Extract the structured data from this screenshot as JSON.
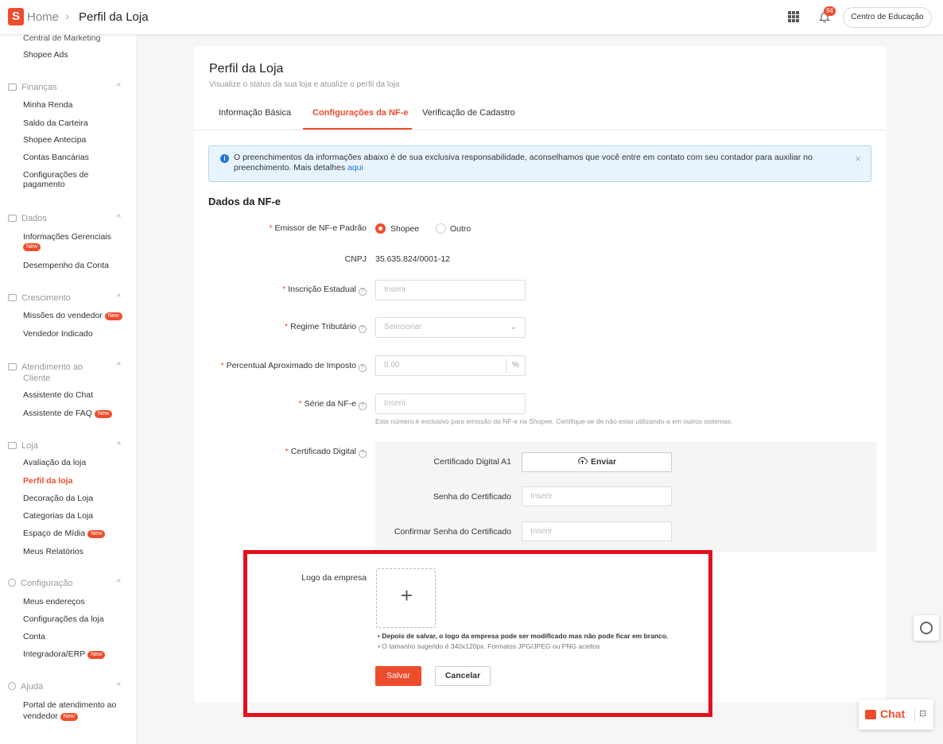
{
  "topbar": {
    "logo_letter": "S",
    "home": "Home",
    "sep": "›",
    "current": "Perfil da Loja",
    "notifications": "94",
    "education_button": "Centro de Educação"
  },
  "sidebar": {
    "marketing_partial": "Central de Marketing",
    "shopee_ads": "Shopee Ads",
    "financas": {
      "title": "Finanças",
      "items": [
        "Minha Renda",
        "Saldo da Carteira",
        "Shopee Antecipa",
        "Contas Bancárias",
        "Configurações de",
        "pagamento"
      ]
    },
    "dados": {
      "title": "Dados",
      "items": [
        "Informações Gerenciais",
        "Desempenho da Conta"
      ]
    },
    "crescimento": {
      "title": "Crescimento",
      "items": [
        "Missões do vendedor",
        "Vendedor Indicado"
      ]
    },
    "atendimento": {
      "title": "Atendimento ao",
      "title2": "Cliente",
      "items": [
        "Assistente do Chat",
        "Assistente de FAQ"
      ]
    },
    "loja": {
      "title": "Loja",
      "items": [
        "Avaliação da loja",
        "Perfil da loja",
        "Decoração da Loja",
        "Categorias da Loja",
        "Espaço de Mídia",
        "Meus Relatórios"
      ]
    },
    "configuracao": {
      "title": "Configuração",
      "items": [
        "Meus endereços",
        "Configurações da loja",
        "Conta",
        "Integradora/ERP"
      ]
    },
    "ajuda": {
      "title": "Ajuda",
      "items": [
        "Portal de atendimento ao",
        "vendedor"
      ]
    },
    "new_badge": "New",
    "chevron": "^"
  },
  "page": {
    "title": "Perfil da Loja",
    "subtitle": "Visualize o status da sua loja e atualize o perfil da loja",
    "tabs": [
      "Informação Básica",
      "Configurações da NF-e",
      "Verificação de Cadastro"
    ]
  },
  "info": {
    "icon": "i",
    "text": "O preenchimentos da informações abaixo é de sua exclusiva responsabilidade, aconselhamos que você entre em contato com seu contador para auxiliar no preenchimento. Mais detalhes ",
    "link": "aqui",
    "close": "×"
  },
  "form": {
    "section_title": "Dados da NF-e",
    "required_mark": "*",
    "help": "?",
    "emissor_label": "Emissor de NF-e Padrão",
    "emissor_options": [
      "Shopee",
      "Outro"
    ],
    "emissor_selected": "Shopee",
    "cnpj_label": "CNPJ",
    "cnpj_value": "35.635.824/0001-12",
    "ie_label": "Inscrição Estadual",
    "ie_placeholder": "Inserir",
    "regime_label": "Regime Tributário",
    "regime_placeholder": "Selecionar",
    "regime_arrow": "⌄",
    "percentual_label": "Percentual Aproximado de Imposto",
    "percentual_placeholder": "0.00",
    "percentual_unit": "%",
    "serie_label": "Série da NF-e",
    "serie_placeholder": "Inserir",
    "serie_hint": "Este número é exclusivo para emissão da NF-e na Shopee. Certifique-se de não estar utilizando-a em outros sistemas.",
    "cert_label": "Certificado Digital",
    "cert_a1_label": "Certificado Digital A1",
    "cert_button": "Enviar",
    "cert_password_label": "Senha do Certificado",
    "cert_password_placeholder": "Inserir",
    "cert_confirm_label": "Confirmar Senha do Certificado",
    "cert_confirm_placeholder": "Inserir",
    "logo_label": "Logo da empresa",
    "upload_plus": "+",
    "notes": [
      "Depois de salvar, o logo da empresa pode ser modificado mas não pode ficar em branco.",
      "O tamanho sugerido é 340x120px. Formatos JPG/JPEG ou PNG aceitos"
    ],
    "bullet": "•",
    "save": "Salvar",
    "cancel": "Cancelar"
  },
  "chat": {
    "label": "Chat",
    "minimize": "⊡"
  },
  "colors": {
    "brand": "#ee4d2d",
    "info_bg": "#e8f4fd",
    "link": "#2673dd",
    "highlight_box": "#e2101c"
  }
}
